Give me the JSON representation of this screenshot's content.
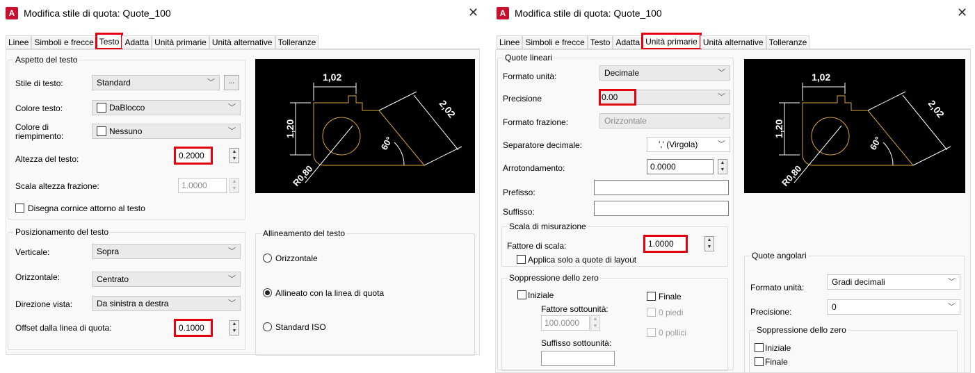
{
  "left": {
    "title": "Modifica stile di quota: Quote_100",
    "tabs": [
      "Linee",
      "Simboli e frecce",
      "Testo",
      "Adatta",
      "Unità primarie",
      "Unità alternative",
      "Tolleranze"
    ],
    "aspect": {
      "title": "Aspetto del testo",
      "style_label": "Stile di testo:",
      "style_value": "Standard",
      "style_btn": "...",
      "color_label": "Colore testo:",
      "color_value": "DaBlocco",
      "fill_label_1": "Colore di",
      "fill_label_2": "riempimento:",
      "fill_value": "Nessuno",
      "height_label": "Altezza del testo:",
      "height_value": "0.2000",
      "fraction_label": "Scala altezza frazione:",
      "fraction_value": "1.0000",
      "frame_label": "Disegna cornice attorno al testo"
    },
    "placement": {
      "title": "Posizionamento del testo",
      "vertical_label": "Verticale:",
      "vertical_value": "Sopra",
      "horizontal_label": "Orizzontale:",
      "horizontal_value": "Centrato",
      "direction_label": "Direzione vista:",
      "direction_value": "Da sinistra a destra",
      "offset_label": "Offset dalla linea di quota:",
      "offset_value": "0.1000"
    },
    "alignment": {
      "title": "Allineamento del testo",
      "opt1": "Orizzontale",
      "opt2": "Allineato con la linea di quota",
      "opt3": "Standard ISO"
    }
  },
  "right": {
    "title": "Modifica stile di quota: Quote_100",
    "tabs": [
      "Linee",
      "Simboli e frecce",
      "Testo",
      "Adatta",
      "Unità primarie",
      "Unità alternative",
      "Tolleranze"
    ],
    "linear": {
      "title": "Quote lineari",
      "unit_label": "Formato unità:",
      "unit_value": "Decimale",
      "precision_label": "Precisione",
      "precision_value": "0.00",
      "fraction_label": "Formato frazione:",
      "fraction_value": "Orizzontale",
      "decimal_label": "Separatore decimale:",
      "decimal_value": "',' (Virgola)",
      "round_label": "Arrotondamento:",
      "round_value": "0.0000",
      "prefix_label": "Prefisso:",
      "prefix_value": "",
      "suffix_label": "Suffisso:",
      "suffix_value": ""
    },
    "scale": {
      "title": "Scala di misurazione",
      "factor_label": "Fattore di scala:",
      "factor_value": "1.0000",
      "layout_label": "Applica solo a quote di layout"
    },
    "zero": {
      "title": "Soppressione dello zero",
      "leading": "Iniziale",
      "trailing": "Finale",
      "subunit_factor_label": "Fattore sottounità:",
      "subunit_factor_value": "100.0000",
      "feet": "0 piedi",
      "inches": "0 pollici",
      "subunit_suffix_label": "Suffisso sottounità:",
      "subunit_suffix_value": ""
    },
    "angular": {
      "title": "Quote angolari",
      "unit_label": "Formato unità:",
      "unit_value": "Gradi decimali",
      "precision_label": "Precisione:",
      "precision_value": "0",
      "zero_title": "Soppressione dello zero",
      "leading": "Iniziale",
      "trailing": "Finale"
    }
  },
  "preview": {
    "top_dim": "1,02",
    "left_dim": "1,20",
    "diag_dim": "2,02",
    "angle_dim": "60°",
    "radius_dim": "R0,80"
  },
  "colors": {
    "highlight": "#e3000f",
    "preview_bg": "#000000",
    "geometry": "#d8a43c",
    "dims": "#ffffff"
  },
  "icons": {
    "app": "autocad-a-icon",
    "close": "close-x-icon"
  }
}
